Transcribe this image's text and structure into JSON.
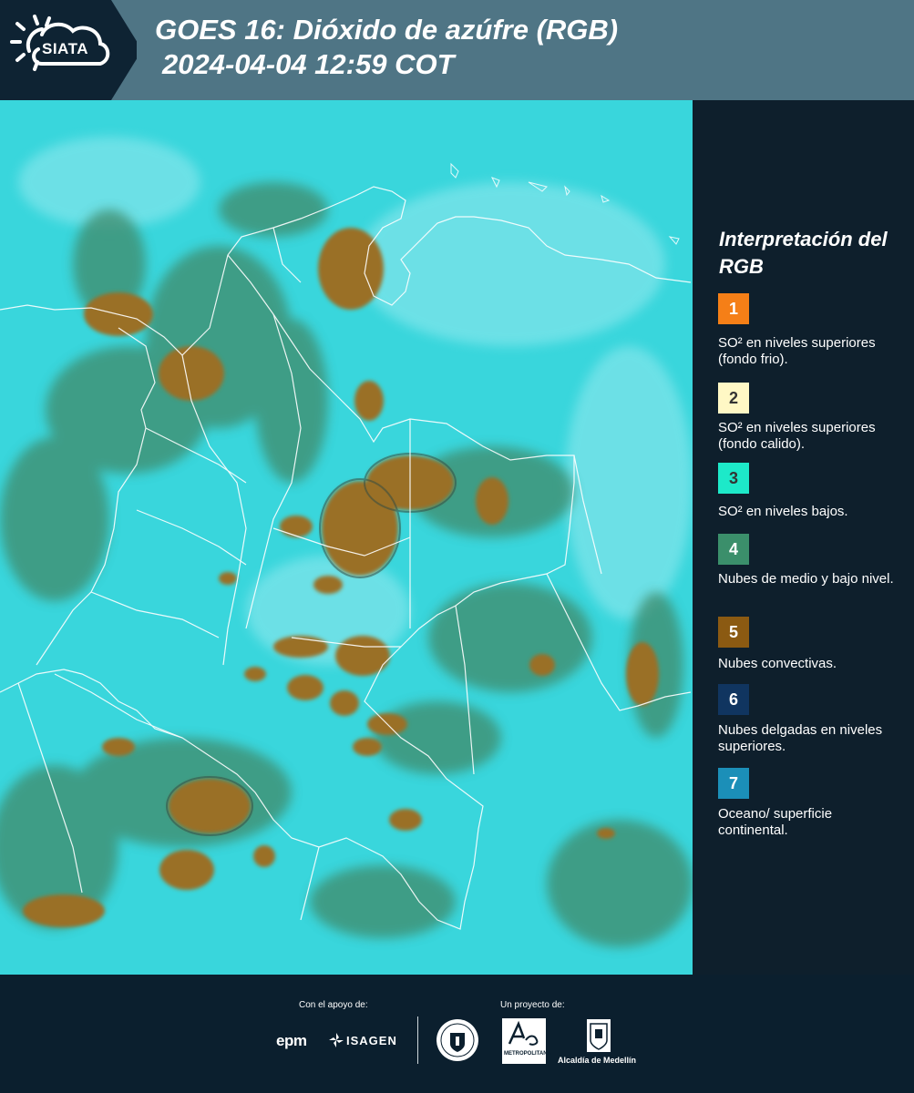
{
  "header": {
    "logo_text": "SIATA",
    "title_line1": "GOES 16: Dióxido de azúfre (RGB)",
    "title_line2": "2024-04-04 12:59 COT"
  },
  "legend": {
    "title": "Interpretación del RGB",
    "items": [
      {
        "number": "1",
        "color": "#f57f17",
        "text": "SO² en niveles superiores (fondo frio)."
      },
      {
        "number": "2",
        "color": "#fff8c5",
        "text": "SO² en niveles superiores (fondo calido)."
      },
      {
        "number": "3",
        "color": "#1de9c9",
        "text": "SO² en niveles bajos."
      },
      {
        "number": "4",
        "color": "#3b8f6b",
        "text": "Nubes de medio y bajo nivel."
      },
      {
        "number": "5",
        "color": "#8b5a12",
        "text": "Nubes convectivas."
      },
      {
        "number": "6",
        "color": "#103560",
        "text": "Nubes delgadas en niveles superiores."
      },
      {
        "number": "7",
        "color": "#1b8fb8",
        "text": "Oceano/ superficie continental."
      }
    ]
  },
  "footer": {
    "support_label": "Con el apoyo de:",
    "project_label": "Un proyecto de:",
    "epm": "epm",
    "isagen": "ISAGEN",
    "metropolitana": "METROPOLITANA",
    "alcaldia": "Alcaldía de Medellín"
  },
  "colors": {
    "background_cyan": "#39d6dc",
    "cloud_green": "#3f8a6a",
    "convective_brown": "#9a7028",
    "header_bar": "#4f7585",
    "panel_dark": "#0e1f2c"
  }
}
